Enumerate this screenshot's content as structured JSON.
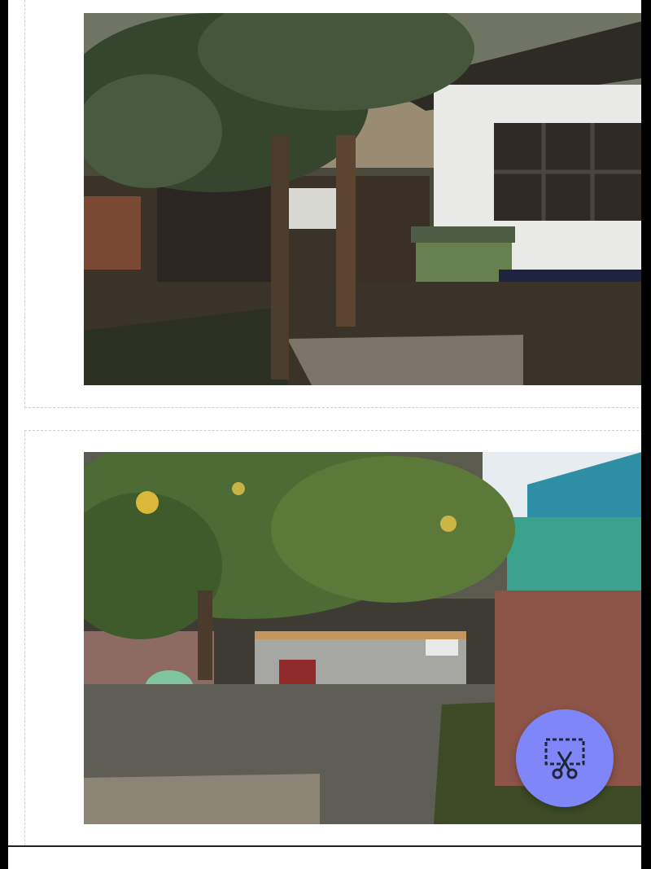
{
  "gallery": {
    "photos": [
      {
        "icon": "photo-backyard-house"
      },
      {
        "icon": "photo-backyard-lemon-tree"
      }
    ]
  },
  "fab": {
    "icon": "crop-cut-icon",
    "color": "#7f87f8"
  }
}
